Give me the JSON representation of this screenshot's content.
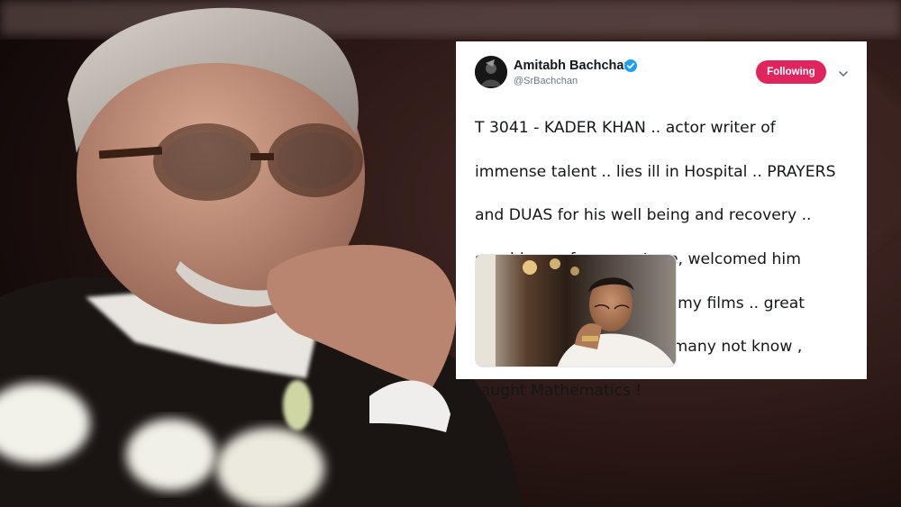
{
  "tweet": {
    "author_name": "Amitabh Bachchan",
    "handle": "@SrBachchan",
    "verified": true,
    "follow_label": "Following",
    "lines": [
      "T 3041 - KADER KHAN .. actor writer of",
      "immense talent .. lies ill in Hospital .. PRAYERS",
      "and DUAS for his well being and recovery ..",
      "saw him perform on stage, welcomed him",
      "and his prolific writing for my films .. great",
      "company, a Libran .. and many not know ,",
      "taught Mathematics !"
    ]
  },
  "colors": {
    "follow_button": "#e0245e",
    "verified_badge": "#1da1f2",
    "handle_text": "#657786",
    "body_text": "#14171a"
  },
  "icons": {
    "verified": "verified-badge-icon",
    "more": "chevron-down-icon"
  }
}
